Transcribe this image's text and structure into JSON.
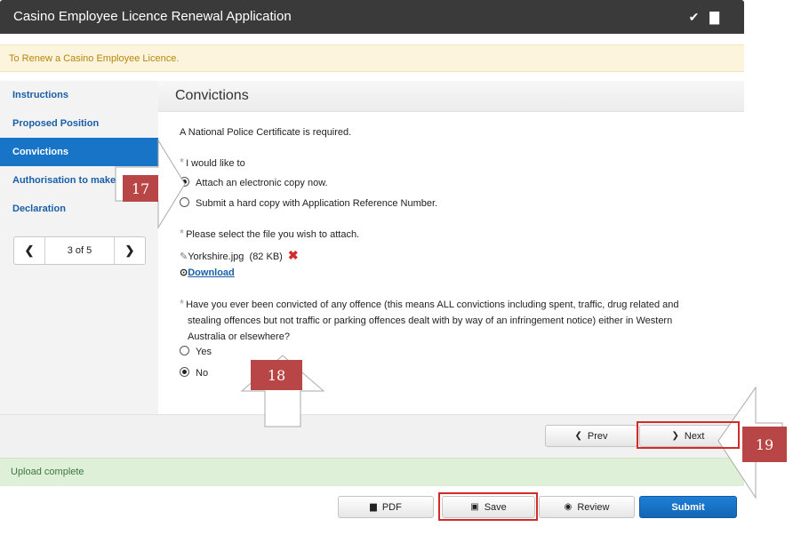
{
  "app": {
    "title": "Casino Employee Licence Renewal Application",
    "titlebar_icons": "✔ ▇"
  },
  "notice": {
    "text": "To Renew a Casino Employee Licence."
  },
  "sidebar": {
    "items": [
      {
        "label": "Instructions",
        "active": false
      },
      {
        "label": "Proposed Position",
        "active": false
      },
      {
        "label": "Convictions",
        "active": true
      },
      {
        "label": "Authorisation to make",
        "active": false
      },
      {
        "label": "Declaration",
        "active": false
      }
    ],
    "pager": {
      "prev": "❮",
      "label": "3 of 5",
      "next": "❯"
    }
  },
  "section": {
    "title": "Convictions",
    "intro": "A National Police Certificate is required.",
    "q1": {
      "label": "I would like to",
      "options": [
        {
          "label": "Attach an electronic copy now.",
          "selected": true
        },
        {
          "label": "Submit a hard copy with Application Reference Number.",
          "selected": false
        }
      ]
    },
    "file": {
      "label": "Please select the file you wish to attach.",
      "name": "Yorkshire.jpg",
      "size": "(82 KB)",
      "download": "Download"
    },
    "q2": {
      "label_line1": "Have you ever been convicted of any offence (this means ALL convictions including spent, traffic, drug related and",
      "label_line2": "stealing offences but not traffic or parking offences dealt with by way of an infringement notice) either in Western",
      "label_line3": "Australia or elsewhere?",
      "options": [
        {
          "label": "Yes",
          "selected": false
        },
        {
          "label": "No",
          "selected": true
        }
      ]
    }
  },
  "nav": {
    "prev": "Prev",
    "next": "Next"
  },
  "status": {
    "text": "Upload complete"
  },
  "footer": {
    "pdf": "PDF",
    "save": "Save",
    "review": "Review",
    "submit": "Submit"
  },
  "callouts": {
    "c17": "17",
    "c18": "18",
    "c19": "19"
  },
  "colors": {
    "accent": "#1874c7",
    "callout": "#b94646",
    "highlight": "#d62a2a"
  }
}
